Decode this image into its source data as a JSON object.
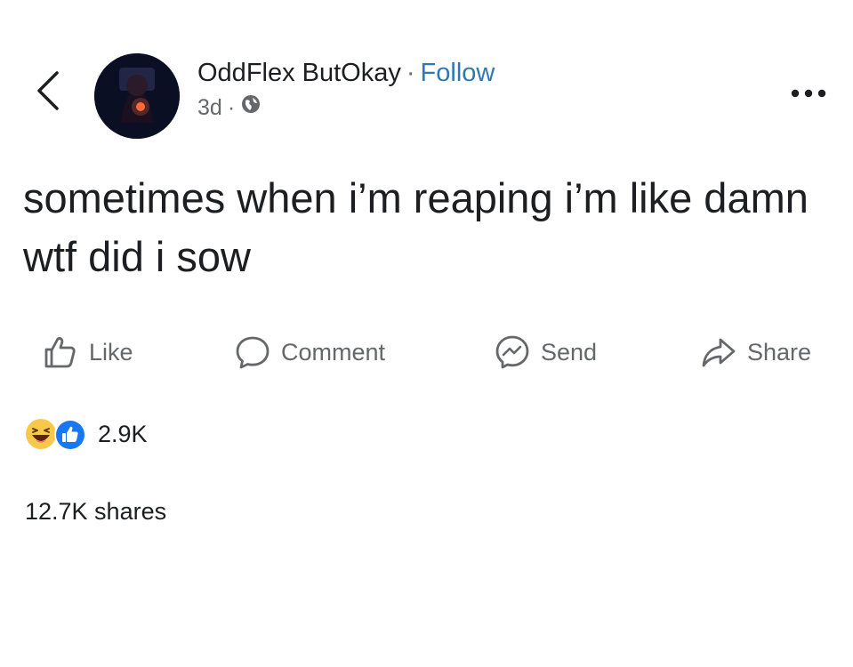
{
  "nav": {
    "back_icon": "chevron-left-icon"
  },
  "post_header": {
    "avatar_icon": "profile-avatar",
    "author_name": "OddFlex ButOkay",
    "separator": "·",
    "follow_label": "Follow",
    "timestamp": "3d",
    "meta_separator": "·",
    "privacy_icon": "globe-icon",
    "more_icon": "ellipsis-icon"
  },
  "post": {
    "text": "sometimes when i’m reaping i’m like damn wtf did i sow"
  },
  "actions": [
    {
      "label": "Like",
      "icon": "thumbs-up-icon"
    },
    {
      "label": "Comment",
      "icon": "comment-bubble-icon"
    },
    {
      "label": "Send",
      "icon": "messenger-icon"
    },
    {
      "label": "Share",
      "icon": "share-arrow-icon"
    }
  ],
  "reactions": {
    "icons": [
      "haha-reaction-icon",
      "like-reaction-icon"
    ],
    "count": "2.9K"
  },
  "shares": {
    "text": "12.7K shares"
  },
  "colors": {
    "accent_link": "#2f78b6",
    "like_reaction": "#1877f2",
    "haha_reaction": "#f7c84a",
    "muted_text": "#65676b",
    "primary_text": "#1c1e21"
  }
}
